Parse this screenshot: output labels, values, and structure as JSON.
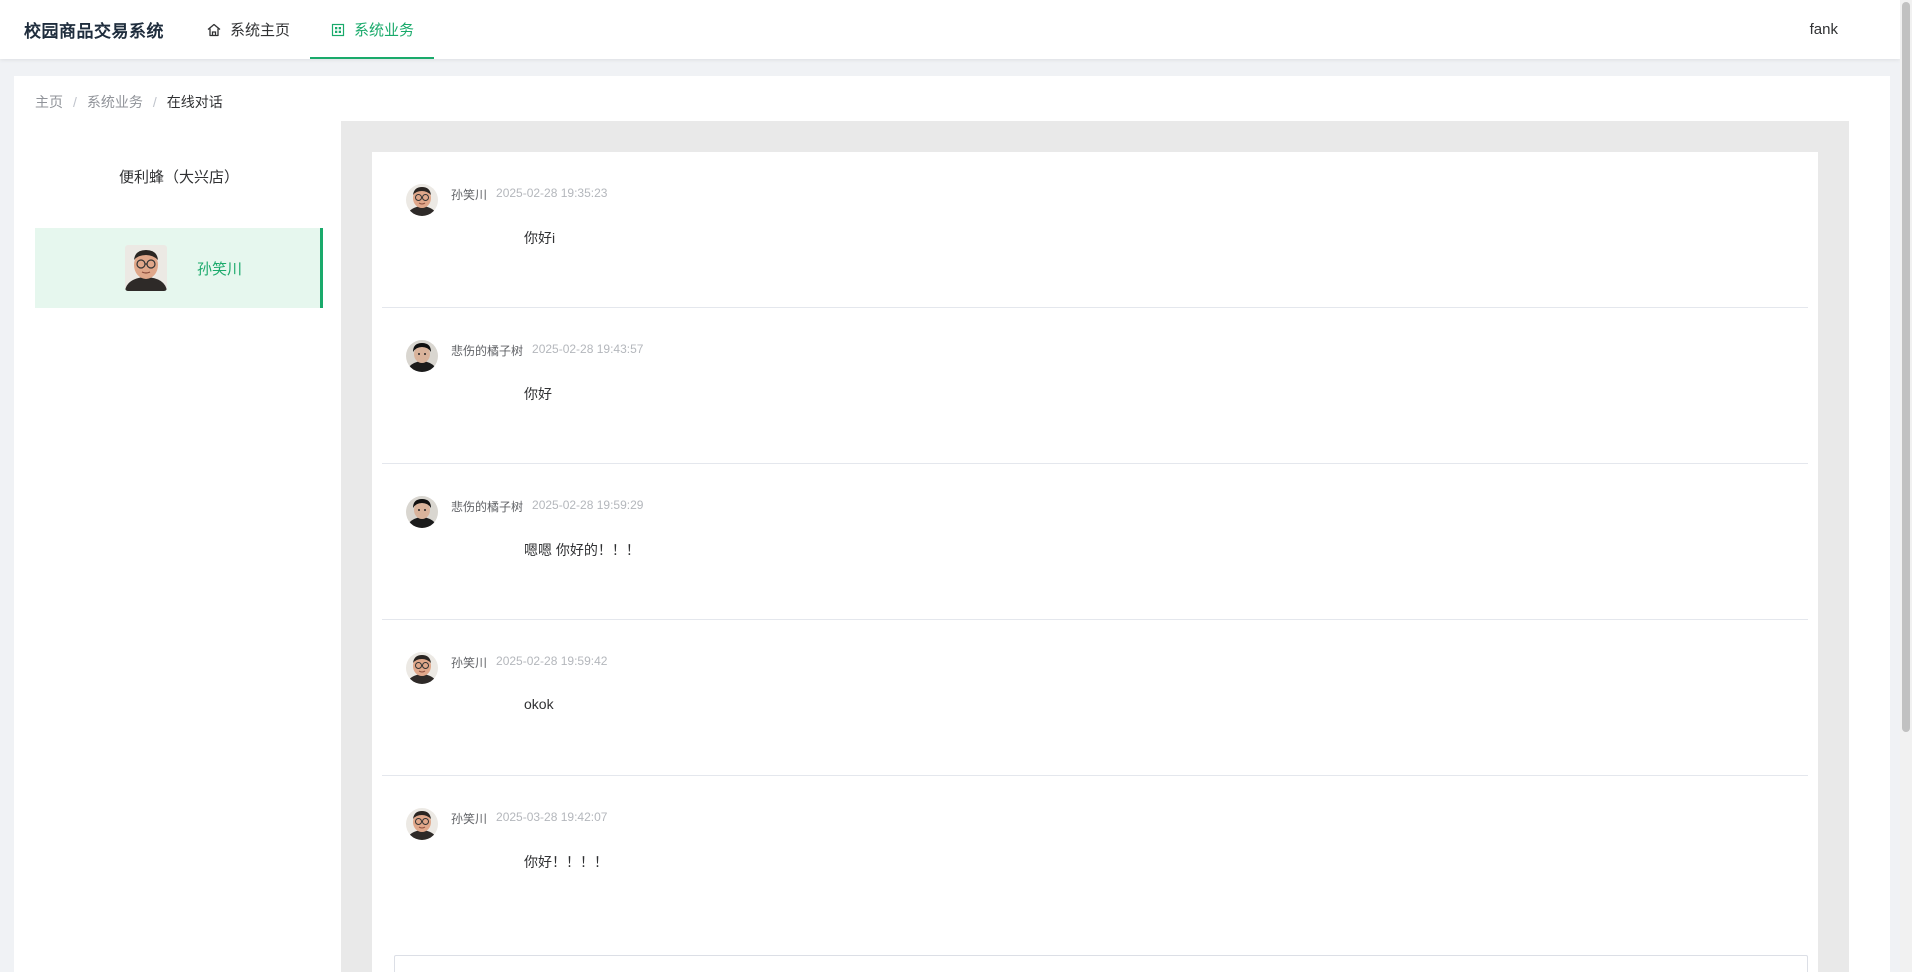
{
  "header": {
    "app_title": "校园商品交易系统",
    "nav": [
      {
        "label": "系统主页",
        "icon": "home-icon",
        "active": false
      },
      {
        "label": "系统业务",
        "icon": "grid-icon",
        "active": true
      }
    ],
    "user": "fank"
  },
  "colors": {
    "accent": "#1aaa6b",
    "active_bg": "#e6f7ee"
  },
  "breadcrumb": [
    "主页",
    "系统业务",
    "在线对话"
  ],
  "contacts": {
    "shop_title": "便利蜂（大兴店）",
    "items": [
      {
        "name": "孙笑川",
        "avatar": "man-glasses-avatar",
        "selected": true
      }
    ]
  },
  "messages": [
    {
      "sender": "孙笑川",
      "time": "2025-02-28 19:35:23",
      "text": "你好i",
      "avatar": "man-glasses-avatar"
    },
    {
      "sender": "悲伤的橘子树",
      "time": "2025-02-28 19:43:57",
      "text": "你好",
      "avatar": "dark-hair-avatar"
    },
    {
      "sender": "悲伤的橘子树",
      "time": "2025-02-28 19:59:29",
      "text": "嗯嗯 你好的！！！",
      "avatar": "dark-hair-avatar"
    },
    {
      "sender": "孙笑川",
      "time": "2025-02-28 19:59:42",
      "text": "okok",
      "avatar": "man-glasses-avatar"
    },
    {
      "sender": "孙笑川",
      "time": "2025-03-28 19:42:07",
      "text": "你好！！！！",
      "avatar": "man-glasses-avatar"
    }
  ]
}
